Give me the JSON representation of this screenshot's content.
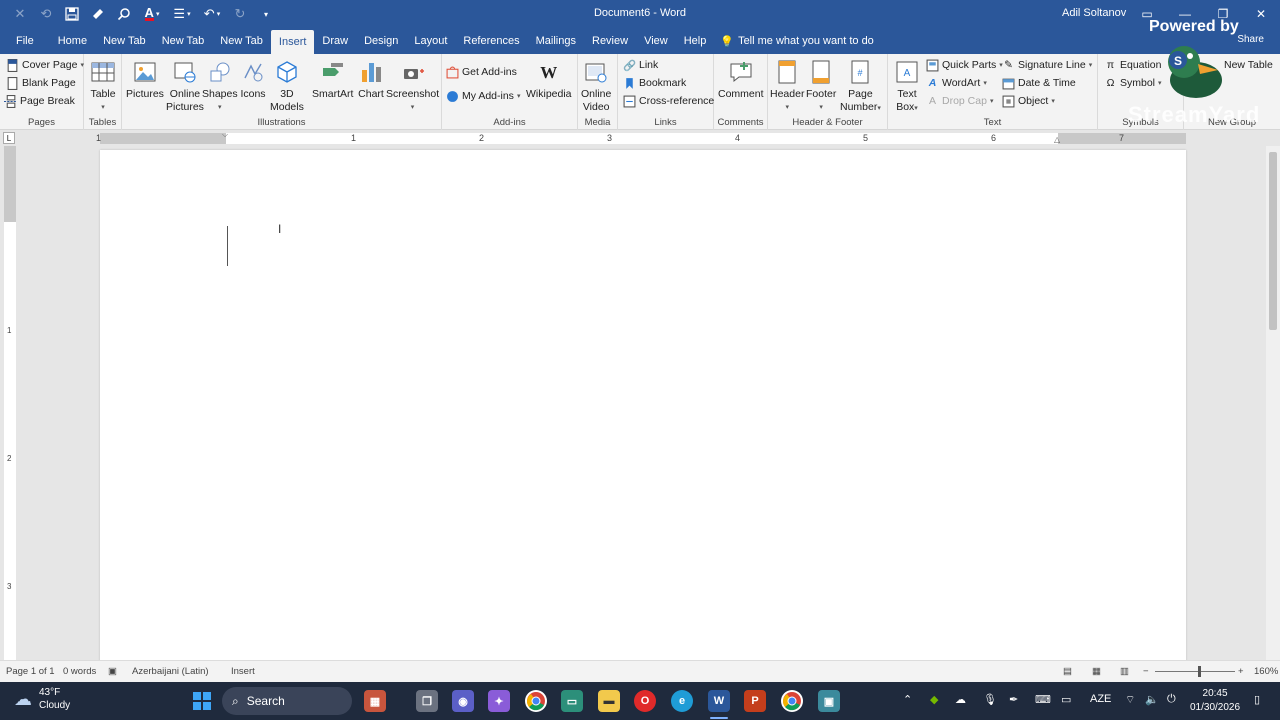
{
  "window": {
    "title": "Document6 - Word",
    "user": "Adil Soltanov"
  },
  "tabs": [
    "File",
    "Home",
    "New Tab",
    "New Tab",
    "New Tab",
    "Insert",
    "Draw",
    "Design",
    "Layout",
    "References",
    "Mailings",
    "Review",
    "View",
    "Help"
  ],
  "active_tab": "Insert",
  "tell_me": "Tell me what you want to do",
  "share": "Share",
  "ribbon": {
    "pages": {
      "label": "Pages",
      "cover_page": "Cover Page",
      "blank_page": "Blank Page",
      "page_break": "Page Break"
    },
    "tables": {
      "label": "Tables",
      "table": "Table"
    },
    "illustrations": {
      "label": "Illustrations",
      "pictures": "Pictures",
      "online_pictures_1": "Online",
      "online_pictures_2": "Pictures",
      "shapes": "Shapes",
      "icons": "Icons",
      "models_1": "3D",
      "models_2": "Models",
      "smartart": "SmartArt",
      "chart": "Chart",
      "screenshot": "Screenshot"
    },
    "addins": {
      "label": "Add-ins",
      "get": "Get Add-ins",
      "my": "My Add-ins",
      "wikipedia": "Wikipedia"
    },
    "media": {
      "label": "Media",
      "online_video_1": "Online",
      "online_video_2": "Video"
    },
    "links": {
      "label": "Links",
      "link": "Link",
      "bookmark": "Bookmark",
      "cross_reference": "Cross-reference"
    },
    "comments": {
      "label": "Comments",
      "comment": "Comment"
    },
    "header_footer": {
      "label": "Header & Footer",
      "header": "Header",
      "footer": "Footer",
      "page_number_1": "Page",
      "page_number_2": "Number"
    },
    "text": {
      "label": "Text",
      "text_box_1": "Text",
      "text_box_2": "Box",
      "quick_parts": "Quick Parts",
      "wordart": "WordArt",
      "drop_cap": "Drop Cap",
      "signature_line": "Signature Line",
      "date_time": "Date & Time",
      "object": "Object"
    },
    "symbols": {
      "label": "Symbols",
      "equation": "Equation",
      "symbol": "Symbol"
    },
    "new_group": {
      "label": "New Group",
      "new_table": "New Table"
    }
  },
  "ruler": {
    "numbers": [
      "1",
      "1",
      "2",
      "3",
      "4",
      "5",
      "6",
      "7"
    ],
    "vertical": [
      "1",
      "2",
      "3"
    ]
  },
  "status": {
    "page": "Page 1 of 1",
    "words": "0 words",
    "language": "Azerbaijani (Latin)",
    "mode": "Insert",
    "zoom": "160%"
  },
  "taskbar": {
    "temp": "43°F",
    "weather": "Cloudy",
    "search": "Search",
    "lang": "AZE",
    "time": "20:45",
    "date": "01/30/2026"
  },
  "overlay": {
    "powered_by": "Powered by",
    "brand": "StreamYard"
  },
  "colors": {
    "word_blue": "#2b579a",
    "ribbon_bg": "#f3f3f3",
    "taskbar": "#1f2a3d"
  }
}
